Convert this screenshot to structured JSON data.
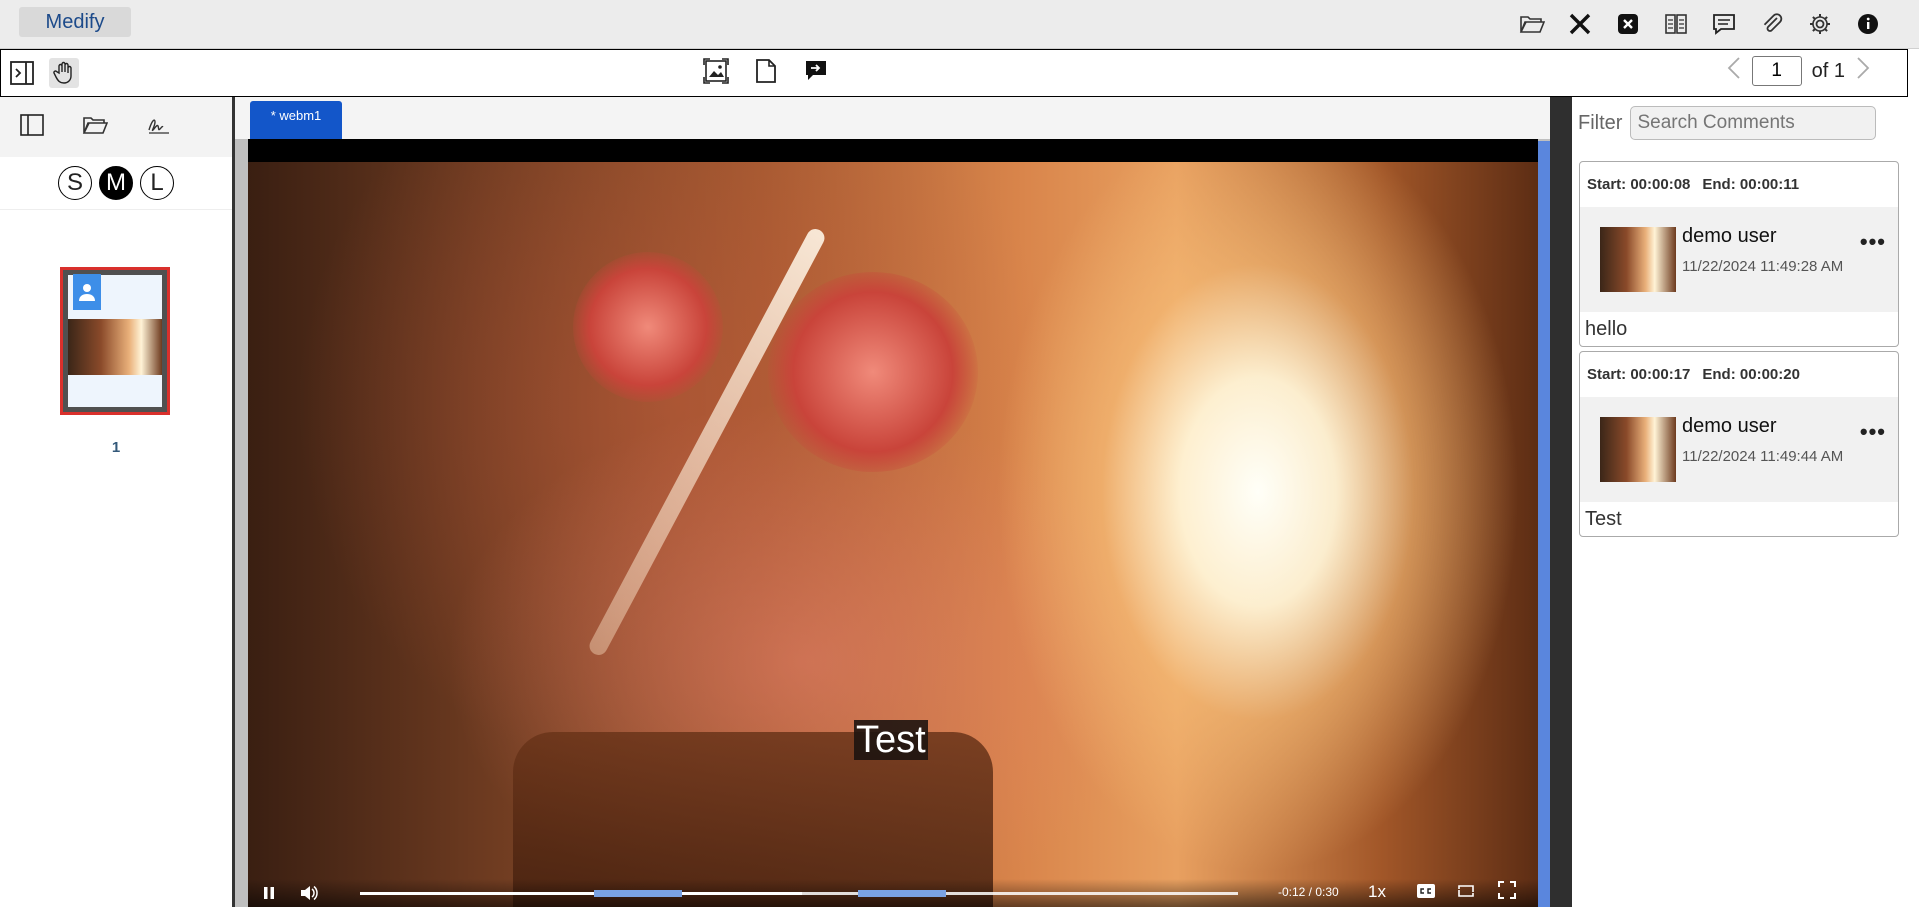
{
  "app": {
    "brand": "Medify"
  },
  "top_icons": [
    "folder-open-icon",
    "close-icon",
    "close-box-icon",
    "compare-icon",
    "comments-icon",
    "paperclip-icon",
    "gear-icon",
    "info-icon"
  ],
  "pager": {
    "current": "1",
    "total_label": "of 1"
  },
  "left_panel": {
    "sizes": [
      "S",
      "M",
      "L"
    ],
    "active_size": "M",
    "thumbnails": [
      {
        "page": "1"
      }
    ]
  },
  "document_tab": {
    "label": "* webm1"
  },
  "video": {
    "caption": "Test",
    "time": "-0:12 / 0:30",
    "speed": "1x",
    "progress": 0.503,
    "markers": [
      {
        "start": 0.267,
        "end": 0.367
      },
      {
        "start": 0.567,
        "end": 0.667
      }
    ]
  },
  "comments_panel": {
    "filter_label": "Filter",
    "search_placeholder": "Search Comments",
    "comments": [
      {
        "start": "Start: 00:00:08",
        "end": "End: 00:00:11",
        "user": "demo user",
        "date": "11/22/2024 11:49:28 AM",
        "text": "hello"
      },
      {
        "start": "Start: 00:00:17",
        "end": "End: 00:00:20",
        "user": "demo user",
        "date": "11/22/2024 11:49:44 AM",
        "text": "Test"
      }
    ]
  },
  "colors": {
    "tab_blue": "#1356c9",
    "scroll_blue": "#5a86dd",
    "selected_thumb_border": "#d9302c"
  }
}
